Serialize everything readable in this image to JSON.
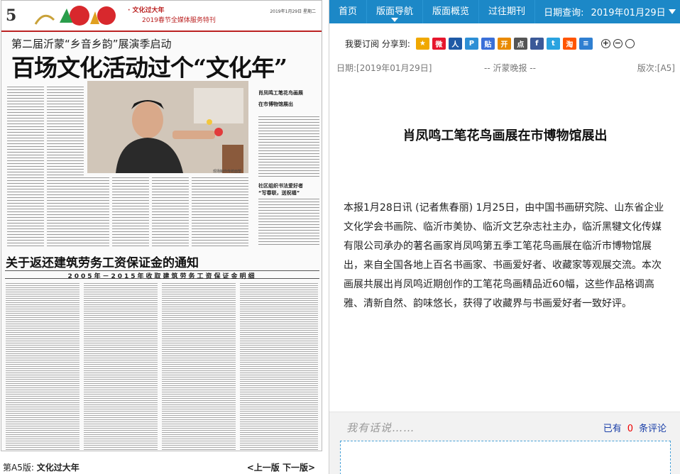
{
  "paper": {
    "page_number": "5",
    "section": "· 文化过大年",
    "special": "2019春节全媒体服务特刊",
    "mast_date": "2019年1月29日  星期二",
    "sub_headline": "第二届沂蒙“乡音乡韵”展演季启动",
    "headline": "百场文化活动过个“文化年”",
    "photo_caption": "现场制作传统面塑",
    "side_article_1": "肖凤鸣工笔花鸟画展",
    "side_article_1b": "在市博物馆展出",
    "side_article_2": "社区组织书法爱好者",
    "side_article_2b": "“写春联，送祝福”",
    "notice_headline": "关于返还建筑劳务工资保证金的通知",
    "table_title": "2005年－2015年收取建筑劳务工资保证金明细"
  },
  "left_footer": {
    "edition_prefix": "第A5版:",
    "edition_name": "文化过大年",
    "prev": "<上一版",
    "next": "下一版>"
  },
  "nav": {
    "items": [
      "首页",
      "版面导航",
      "版面概览",
      "过往期刊"
    ],
    "active_index": 1,
    "date_label": "日期查询:",
    "date_value": "2019年01月29日"
  },
  "share": {
    "label": "我要订阅 分享到:",
    "icons": [
      {
        "name": "qzone-icon",
        "glyph": "★",
        "color": "#f0a800"
      },
      {
        "name": "weibo-icon",
        "glyph": "微",
        "color": "#e6162d"
      },
      {
        "name": "renren-icon",
        "glyph": "人",
        "color": "#1f5aa6"
      },
      {
        "name": "pengyou-icon",
        "glyph": "P",
        "color": "#2d8fd5"
      },
      {
        "name": "tieba-icon",
        "glyph": "贴",
        "color": "#3a6fd8"
      },
      {
        "name": "kaixin-icon",
        "glyph": "开",
        "color": "#e98a00"
      },
      {
        "name": "dianping-icon",
        "glyph": "点",
        "color": "#555555"
      },
      {
        "name": "facebook-icon",
        "glyph": "f",
        "color": "#3b5998"
      },
      {
        "name": "twitter-icon",
        "glyph": "t",
        "color": "#2aa3e0"
      },
      {
        "name": "taobao-icon",
        "glyph": "淘",
        "color": "#ff5500"
      },
      {
        "name": "more-icon",
        "glyph": "≡",
        "color": "#2f7fd1"
      }
    ],
    "zoom_in": "+",
    "zoom_out": "−",
    "zoom_reset": "○"
  },
  "article": {
    "date": "日期:[2019年01月29日]",
    "paper_name": "-- 沂蒙晚报 --",
    "edition": "版次:[A5]",
    "title": "肖凤鸣工笔花鸟画展在市博物馆展出",
    "body": "本报1月28日讯  (记者焦春丽)  1月25日，由中国书画研究院、山东省企业文化学会书画院、临沂市美协、临沂文艺杂志社主办，临沂黑犍文化传媒有限公司承办的著名画家肖凤鸣第五季工笔花鸟画展在临沂市博物馆展出，来自全国各地上百名书画家、书画爱好者、收藏家等观展交流。本次画展共展出肖凤鸣近期创作的工笔花鸟画精品近60幅，这些作品格调高雅、清新自然、韵味悠长，获得了收藏界与书画爱好者一致好评。"
  },
  "comments": {
    "label": "我有话说……",
    "prefix": "已有",
    "count": "0",
    "suffix": "条评论"
  }
}
